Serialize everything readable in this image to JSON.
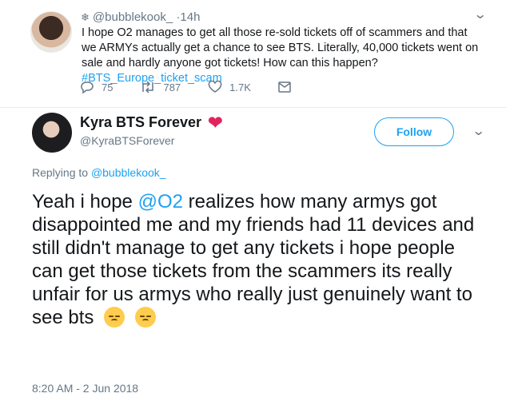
{
  "reply_tweet": {
    "snow_icon": "snowflake",
    "handle": "@bubblekook_",
    "time": "14h",
    "text_main": "I hope O2 manages to get all those re-sold tickets off of scammers and that we ARMYs actually get a chance to see BTS. Literally, 40,000 tickets went on sale and hardly anyone got tickets! How can this happen? ",
    "hashtag": "#BTS_Europe_ticket_scam",
    "counts": {
      "replies": "75",
      "retweets": "787",
      "likes": "1.7K"
    }
  },
  "main_tweet": {
    "name": "Kyra BTS Forever",
    "heart_emoji": "❤",
    "handle": "@KyraBTSForever",
    "follow_label": "Follow",
    "replying_label": "Replying to ",
    "replying_handle": "@bubblekook_",
    "text_prefix": "Yeah i hope ",
    "mention": "@O2",
    "text_body": " realizes how many armys got disappointed me and my friends had 11 devices and still didn't manage to get any tickets i hope people  can get those tickets from the scammers its really unfair for us armys who really just genuinely want to see bts",
    "emojis": [
      "disappointed-face",
      "pensive-face"
    ],
    "timestamp": "8:20 AM - 2 Jun 2018"
  },
  "colors": {
    "link": "#1da1f2",
    "secondary": "#657786",
    "heart": "#e0245e"
  }
}
